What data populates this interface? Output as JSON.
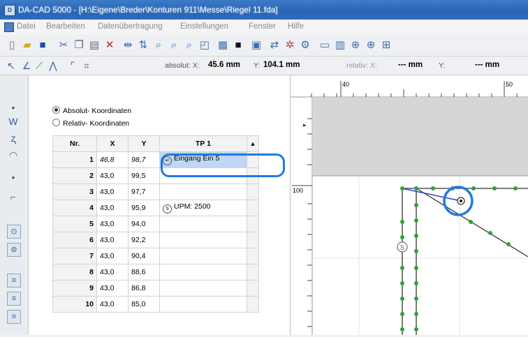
{
  "window": {
    "title": "DA-CAD 5000 - [H:\\Eigene\\Breder\\Konturen 911\\Messe\\Riegel 11.fda]"
  },
  "menu": [
    "Datei",
    "Bearbeiten",
    "Datenübertragung",
    "Einstellungen",
    "Fenster",
    "Hilfe"
  ],
  "toolbar2": {
    "absolut_label": "absolut: X:",
    "abs_x": "45.6 mm",
    "y_label": "Y:",
    "abs_y": "104.1 mm",
    "relativ_label": "relativ: X:",
    "rel_x": "--- mm",
    "rel_y_label": "Y:",
    "rel_y": "--- mm"
  },
  "coords_panel": {
    "absolute_option": "Absolut- Koordinaten",
    "relative_option": "Relativ- Koordinaten",
    "columns": [
      "Nr.",
      "X",
      "Y",
      "TP 1"
    ],
    "rows": [
      {
        "nr": "1",
        "x": "46,8",
        "y": "98,7",
        "tp": "Eingang Ein 5"
      },
      {
        "nr": "2",
        "x": "43,0",
        "y": "99,5",
        "tp": ""
      },
      {
        "nr": "3",
        "x": "43,0",
        "y": "97,7",
        "tp": ""
      },
      {
        "nr": "4",
        "x": "43,0",
        "y": "95,9",
        "tp": "UPM: 2500"
      },
      {
        "nr": "5",
        "x": "43,0",
        "y": "94,0",
        "tp": ""
      },
      {
        "nr": "6",
        "x": "43,0",
        "y": "92,2",
        "tp": ""
      },
      {
        "nr": "7",
        "x": "43,0",
        "y": "90,4",
        "tp": ""
      },
      {
        "nr": "8",
        "x": "43,0",
        "y": "88,6",
        "tp": ""
      },
      {
        "nr": "9",
        "x": "43,0",
        "y": "86,8",
        "tp": ""
      },
      {
        "nr": "10",
        "x": "43,0",
        "y": "85,0",
        "tp": ""
      }
    ]
  },
  "canvas": {
    "ruler_top": [
      "40",
      "50"
    ],
    "ruler_left": [
      "100"
    ]
  }
}
